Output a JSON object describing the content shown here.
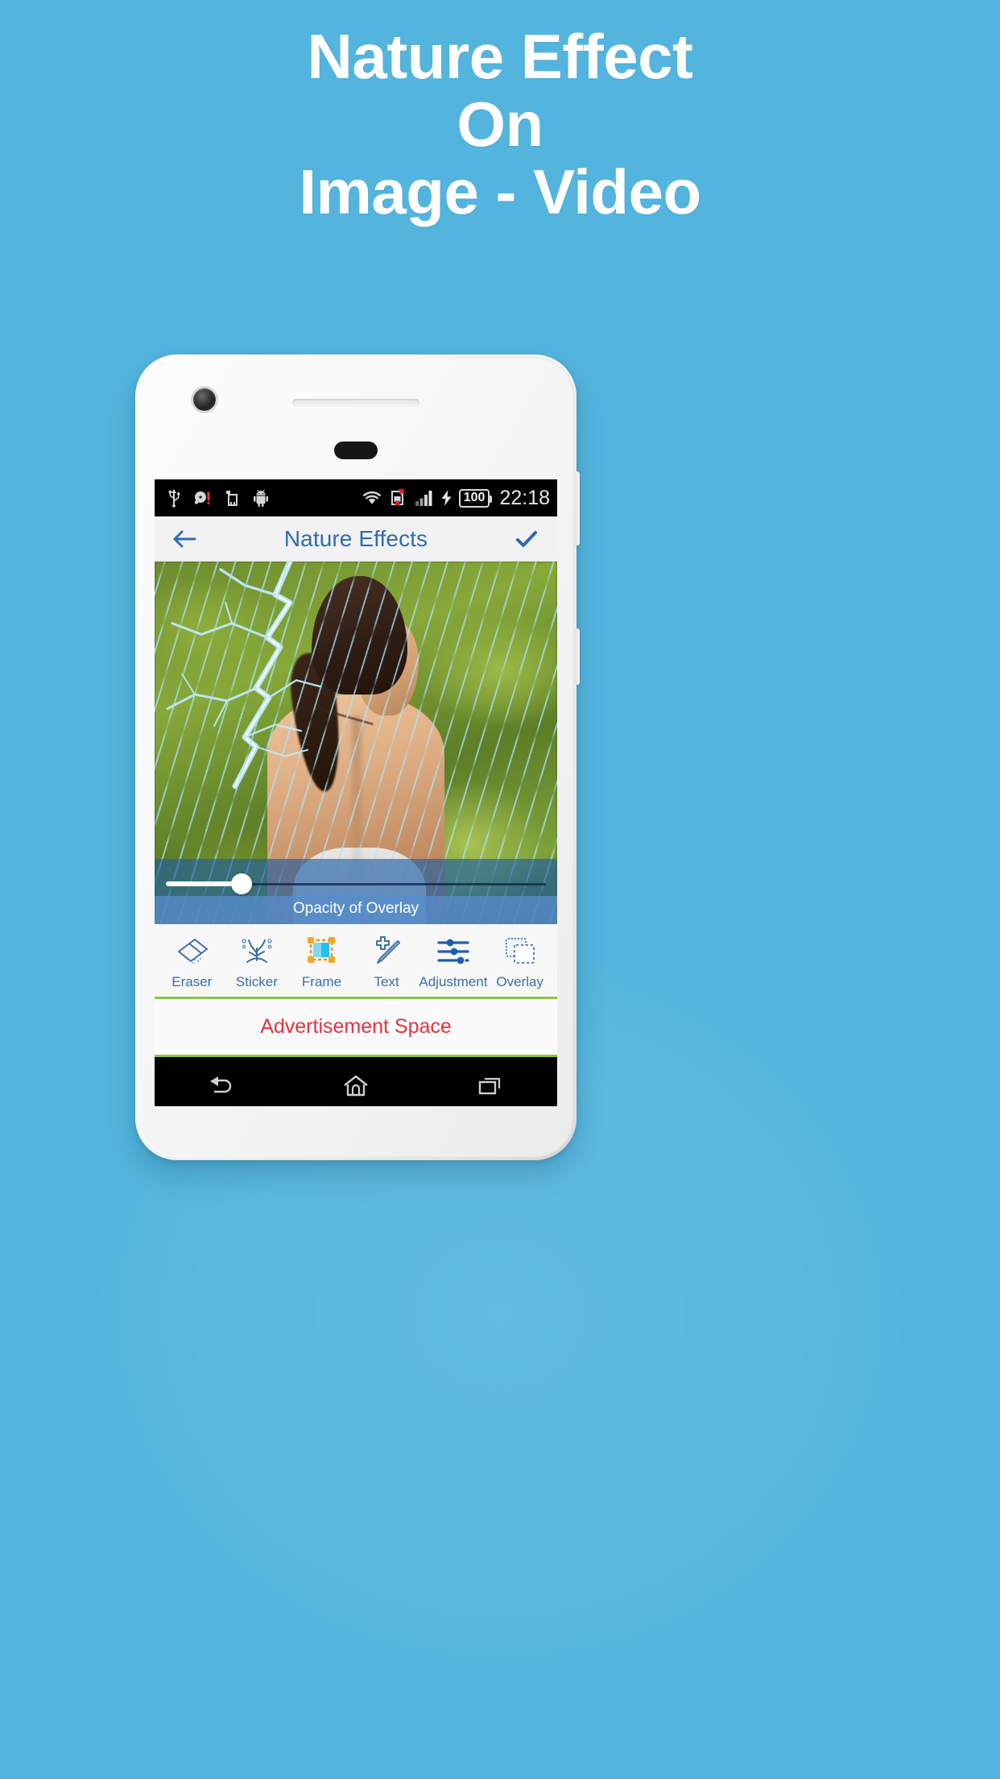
{
  "promo": {
    "headline_lines": [
      "Nature Effect",
      "On",
      "Image - Video"
    ],
    "background_color": "#53b5de",
    "text_color": "#ffffff"
  },
  "status_bar": {
    "time": "22:18",
    "battery_level": "100",
    "icons_left": [
      "usb-icon",
      "alarm-disabled-icon",
      "sd-card-icon",
      "android-icon"
    ],
    "icons_right": [
      "wifi-icon",
      "sim-card-missing-icon",
      "signal-bars-icon",
      "charging-bolt-icon"
    ],
    "background_color": "#000000"
  },
  "app_bar": {
    "title": "Nature Effects",
    "back_icon": "arrow-left-icon",
    "confirm_icon": "check-icon",
    "accent_color": "#2f6bb5"
  },
  "editor": {
    "opacity_slider": {
      "label": "Opacity of Overlay",
      "value": 20,
      "min": 0,
      "max": 100
    },
    "photo_description": "Woman outdoors with rain and lightning nature overlay effect"
  },
  "tools": [
    {
      "label": "Eraser",
      "icon": "eraser-icon",
      "selected": false
    },
    {
      "label": "Sticker",
      "icon": "sticker-icon",
      "selected": false
    },
    {
      "label": "Frame",
      "icon": "frame-icon",
      "selected": true
    },
    {
      "label": "Text",
      "icon": "text-pen-icon",
      "selected": false
    },
    {
      "label": "Adjustment",
      "icon": "sliders-icon",
      "selected": false
    },
    {
      "label": "Overlay",
      "icon": "overlay-icon",
      "selected": false
    }
  ],
  "advertisement": {
    "text": "Advertisement Space",
    "text_color": "#e8323c"
  },
  "nav_bar": {
    "items": [
      "back-nav-icon",
      "home-nav-icon",
      "recents-nav-icon"
    ],
    "background_color": "#000000"
  },
  "accent_colors": {
    "divider_green": "#8cc63e",
    "title_blue": "#2f6bb5",
    "slider_overlay_blue": "#1a5ca4"
  }
}
